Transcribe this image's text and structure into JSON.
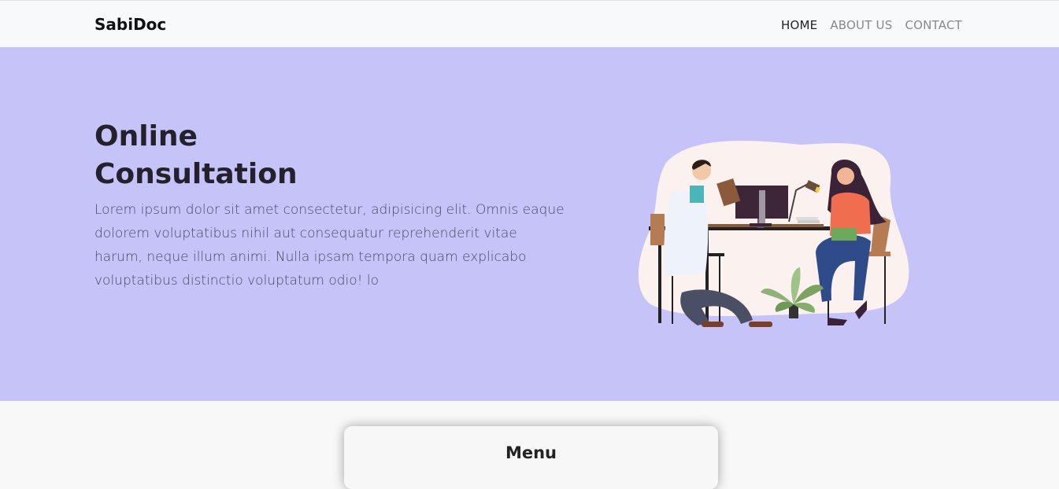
{
  "nav": {
    "brand": "SabiDoc",
    "links": [
      "HOME",
      "ABOUT US",
      "CONTACT"
    ]
  },
  "hero": {
    "title_line1": "Online",
    "title_line2": "Consultation",
    "body": "Lorem ipsum dolor sit amet consectetur, adipisicing elit. Omnis eaque dolorem voluptatibus nihil aut consequatur reprehenderit vitae harum, neque illum animi. Nulla ipsam tempora quam explicabo voluptatibus distinctio voluptatum odio! lo"
  },
  "menu_card": {
    "title": "Menu"
  },
  "colors": {
    "hero_bg": "#c5c3f8",
    "navbar_bg": "#f8f9fa"
  }
}
